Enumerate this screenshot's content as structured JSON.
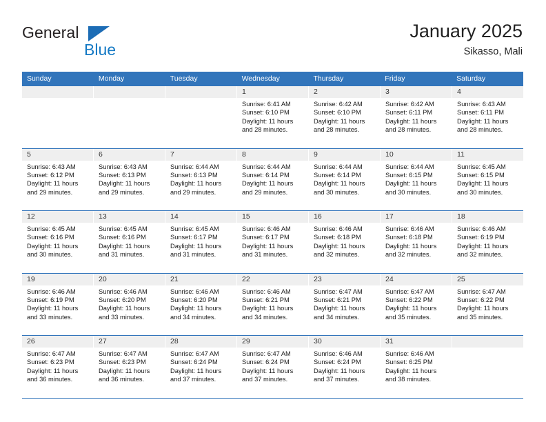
{
  "brand": {
    "name_primary": "General",
    "name_secondary": "Blue",
    "triangle_icon": "triangle-icon"
  },
  "header": {
    "title": "January 2025",
    "location": "Sikasso, Mali"
  },
  "colors": {
    "header_blue": "#3275bb",
    "brand_blue": "#1479c4",
    "daynum_band": "#efefef",
    "text": "#1a1a1a"
  },
  "weekdays": [
    "Sunday",
    "Monday",
    "Tuesday",
    "Wednesday",
    "Thursday",
    "Friday",
    "Saturday"
  ],
  "weeks": [
    [
      {
        "empty": true
      },
      {
        "empty": true
      },
      {
        "empty": true
      },
      {
        "day": "1",
        "sunrise": "Sunrise: 6:41 AM",
        "sunset": "Sunset: 6:10 PM",
        "daylight_1": "Daylight: 11 hours",
        "daylight_2": "and 28 minutes."
      },
      {
        "day": "2",
        "sunrise": "Sunrise: 6:42 AM",
        "sunset": "Sunset: 6:10 PM",
        "daylight_1": "Daylight: 11 hours",
        "daylight_2": "and 28 minutes."
      },
      {
        "day": "3",
        "sunrise": "Sunrise: 6:42 AM",
        "sunset": "Sunset: 6:11 PM",
        "daylight_1": "Daylight: 11 hours",
        "daylight_2": "and 28 minutes."
      },
      {
        "day": "4",
        "sunrise": "Sunrise: 6:43 AM",
        "sunset": "Sunset: 6:11 PM",
        "daylight_1": "Daylight: 11 hours",
        "daylight_2": "and 28 minutes."
      }
    ],
    [
      {
        "day": "5",
        "sunrise": "Sunrise: 6:43 AM",
        "sunset": "Sunset: 6:12 PM",
        "daylight_1": "Daylight: 11 hours",
        "daylight_2": "and 29 minutes."
      },
      {
        "day": "6",
        "sunrise": "Sunrise: 6:43 AM",
        "sunset": "Sunset: 6:13 PM",
        "daylight_1": "Daylight: 11 hours",
        "daylight_2": "and 29 minutes."
      },
      {
        "day": "7",
        "sunrise": "Sunrise: 6:44 AM",
        "sunset": "Sunset: 6:13 PM",
        "daylight_1": "Daylight: 11 hours",
        "daylight_2": "and 29 minutes."
      },
      {
        "day": "8",
        "sunrise": "Sunrise: 6:44 AM",
        "sunset": "Sunset: 6:14 PM",
        "daylight_1": "Daylight: 11 hours",
        "daylight_2": "and 29 minutes."
      },
      {
        "day": "9",
        "sunrise": "Sunrise: 6:44 AM",
        "sunset": "Sunset: 6:14 PM",
        "daylight_1": "Daylight: 11 hours",
        "daylight_2": "and 30 minutes."
      },
      {
        "day": "10",
        "sunrise": "Sunrise: 6:44 AM",
        "sunset": "Sunset: 6:15 PM",
        "daylight_1": "Daylight: 11 hours",
        "daylight_2": "and 30 minutes."
      },
      {
        "day": "11",
        "sunrise": "Sunrise: 6:45 AM",
        "sunset": "Sunset: 6:15 PM",
        "daylight_1": "Daylight: 11 hours",
        "daylight_2": "and 30 minutes."
      }
    ],
    [
      {
        "day": "12",
        "sunrise": "Sunrise: 6:45 AM",
        "sunset": "Sunset: 6:16 PM",
        "daylight_1": "Daylight: 11 hours",
        "daylight_2": "and 30 minutes."
      },
      {
        "day": "13",
        "sunrise": "Sunrise: 6:45 AM",
        "sunset": "Sunset: 6:16 PM",
        "daylight_1": "Daylight: 11 hours",
        "daylight_2": "and 31 minutes."
      },
      {
        "day": "14",
        "sunrise": "Sunrise: 6:45 AM",
        "sunset": "Sunset: 6:17 PM",
        "daylight_1": "Daylight: 11 hours",
        "daylight_2": "and 31 minutes."
      },
      {
        "day": "15",
        "sunrise": "Sunrise: 6:46 AM",
        "sunset": "Sunset: 6:17 PM",
        "daylight_1": "Daylight: 11 hours",
        "daylight_2": "and 31 minutes."
      },
      {
        "day": "16",
        "sunrise": "Sunrise: 6:46 AM",
        "sunset": "Sunset: 6:18 PM",
        "daylight_1": "Daylight: 11 hours",
        "daylight_2": "and 32 minutes."
      },
      {
        "day": "17",
        "sunrise": "Sunrise: 6:46 AM",
        "sunset": "Sunset: 6:18 PM",
        "daylight_1": "Daylight: 11 hours",
        "daylight_2": "and 32 minutes."
      },
      {
        "day": "18",
        "sunrise": "Sunrise: 6:46 AM",
        "sunset": "Sunset: 6:19 PM",
        "daylight_1": "Daylight: 11 hours",
        "daylight_2": "and 32 minutes."
      }
    ],
    [
      {
        "day": "19",
        "sunrise": "Sunrise: 6:46 AM",
        "sunset": "Sunset: 6:19 PM",
        "daylight_1": "Daylight: 11 hours",
        "daylight_2": "and 33 minutes."
      },
      {
        "day": "20",
        "sunrise": "Sunrise: 6:46 AM",
        "sunset": "Sunset: 6:20 PM",
        "daylight_1": "Daylight: 11 hours",
        "daylight_2": "and 33 minutes."
      },
      {
        "day": "21",
        "sunrise": "Sunrise: 6:46 AM",
        "sunset": "Sunset: 6:20 PM",
        "daylight_1": "Daylight: 11 hours",
        "daylight_2": "and 34 minutes."
      },
      {
        "day": "22",
        "sunrise": "Sunrise: 6:46 AM",
        "sunset": "Sunset: 6:21 PM",
        "daylight_1": "Daylight: 11 hours",
        "daylight_2": "and 34 minutes."
      },
      {
        "day": "23",
        "sunrise": "Sunrise: 6:47 AM",
        "sunset": "Sunset: 6:21 PM",
        "daylight_1": "Daylight: 11 hours",
        "daylight_2": "and 34 minutes."
      },
      {
        "day": "24",
        "sunrise": "Sunrise: 6:47 AM",
        "sunset": "Sunset: 6:22 PM",
        "daylight_1": "Daylight: 11 hours",
        "daylight_2": "and 35 minutes."
      },
      {
        "day": "25",
        "sunrise": "Sunrise: 6:47 AM",
        "sunset": "Sunset: 6:22 PM",
        "daylight_1": "Daylight: 11 hours",
        "daylight_2": "and 35 minutes."
      }
    ],
    [
      {
        "day": "26",
        "sunrise": "Sunrise: 6:47 AM",
        "sunset": "Sunset: 6:23 PM",
        "daylight_1": "Daylight: 11 hours",
        "daylight_2": "and 36 minutes."
      },
      {
        "day": "27",
        "sunrise": "Sunrise: 6:47 AM",
        "sunset": "Sunset: 6:23 PM",
        "daylight_1": "Daylight: 11 hours",
        "daylight_2": "and 36 minutes."
      },
      {
        "day": "28",
        "sunrise": "Sunrise: 6:47 AM",
        "sunset": "Sunset: 6:24 PM",
        "daylight_1": "Daylight: 11 hours",
        "daylight_2": "and 37 minutes."
      },
      {
        "day": "29",
        "sunrise": "Sunrise: 6:47 AM",
        "sunset": "Sunset: 6:24 PM",
        "daylight_1": "Daylight: 11 hours",
        "daylight_2": "and 37 minutes."
      },
      {
        "day": "30",
        "sunrise": "Sunrise: 6:46 AM",
        "sunset": "Sunset: 6:24 PM",
        "daylight_1": "Daylight: 11 hours",
        "daylight_2": "and 37 minutes."
      },
      {
        "day": "31",
        "sunrise": "Sunrise: 6:46 AM",
        "sunset": "Sunset: 6:25 PM",
        "daylight_1": "Daylight: 11 hours",
        "daylight_2": "and 38 minutes."
      },
      {
        "empty": true
      }
    ]
  ]
}
